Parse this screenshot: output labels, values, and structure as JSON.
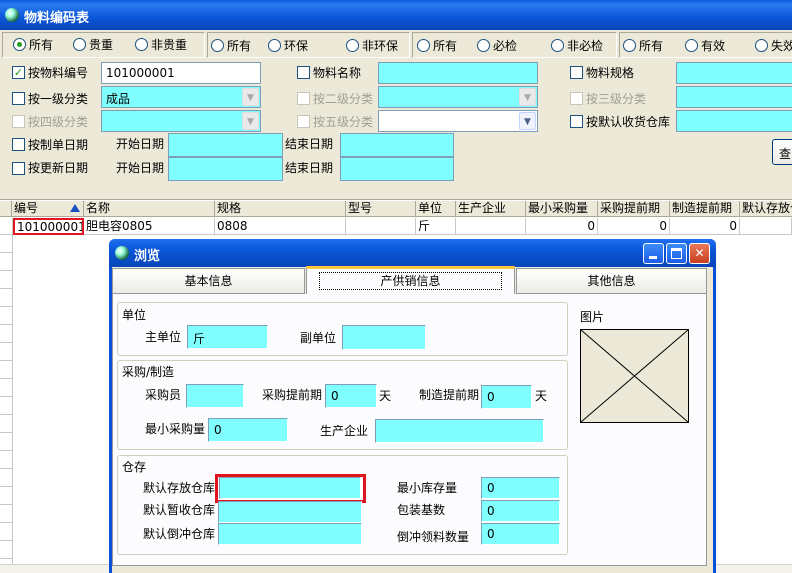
{
  "window": {
    "title": "物料编码表"
  },
  "filters": {
    "group1": [
      "所有",
      "贵重",
      "非贵重"
    ],
    "group2": [
      "所有",
      "环保",
      "非环保"
    ],
    "group3": [
      "所有",
      "必检",
      "非必检"
    ],
    "group4": [
      "所有",
      "有效",
      "失效"
    ]
  },
  "search": {
    "code_label": "按物料编号",
    "code_value": "101000001",
    "name_label": "物料名称",
    "spec_label": "物料规格",
    "cat1_label": "按一级分类",
    "cat1_value": "成品",
    "cat2_label": "按二级分类",
    "cat3_label": "按三级分类",
    "cat4_label": "按四级分类",
    "cat5_label": "按五级分类",
    "default_wh_label": "按默认收货仓库",
    "create_date_label": "按制单日期",
    "update_date_label": "按更新日期",
    "start_date_label": "开始日期",
    "end_date_label": "结束日期",
    "search_button": "查"
  },
  "grid": {
    "columns": [
      "编号",
      "名称",
      "规格",
      "型号",
      "单位",
      "生产企业",
      "最小采购量",
      "采购提前期",
      "制造提前期",
      "默认存放仓"
    ],
    "rows": [
      {
        "code": "101000001",
        "name": "胆电容0805",
        "spec": "0808",
        "model": "",
        "unit": "斤",
        "producer": "",
        "min_purchase": "0",
        "purchase_lead": "0",
        "make_lead": "0",
        "wh": ""
      }
    ]
  },
  "dialog": {
    "title": "浏览",
    "tabs": [
      "基本信息",
      "产供销信息",
      "其他信息"
    ],
    "active_tab": "产供销信息",
    "unit_section": "单位",
    "main_unit_label": "主单位",
    "main_unit_value": "斤",
    "sub_unit_label": "副单位",
    "sub_unit_value": "",
    "purchase_section": "采购/制造",
    "buyer_label": "采购员",
    "buyer_value": "",
    "purchase_lead_label": "采购提前期",
    "purchase_lead_value": "0",
    "day1": "天",
    "make_lead_label": "制造提前期",
    "make_lead_value": "0",
    "day2": "天",
    "min_purchase_label": "最小采购量",
    "min_purchase_value": "0",
    "producer_label": "生产企业",
    "producer_value": "",
    "picture_label": "图片",
    "wh_section": "仓存",
    "default_wh_label": "默认存放仓库",
    "default_wh_value": "",
    "temp_wh_label": "默认暂收仓库",
    "temp_wh_value": "",
    "backflush_wh_label": "默认倒冲仓库",
    "backflush_wh_value": "",
    "min_stock_label": "最小库存量",
    "min_stock_value": "0",
    "pack_base_label": "包装基数",
    "pack_base_value": "0",
    "backflush_qty_label": "倒冲领料数量",
    "backflush_qty_value": "0"
  },
  "colors": {
    "field_cyan": "#80ffff",
    "highlight_red": "#e0141e",
    "titlebar_blue": "#0a55d8"
  }
}
